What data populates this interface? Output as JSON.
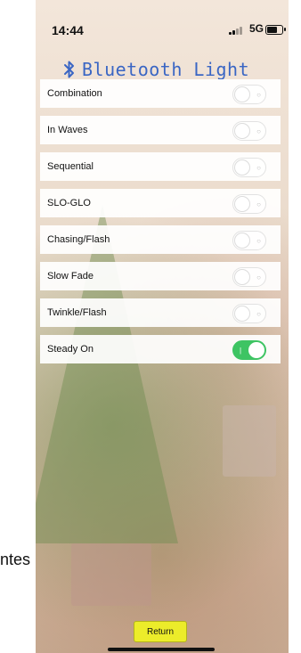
{
  "status_bar": {
    "time": "14:44",
    "network": "5G"
  },
  "app": {
    "title": "Bluetooth Light",
    "title_color": "#3a66c4"
  },
  "modes": [
    {
      "label": "Combination",
      "on": false
    },
    {
      "label": "In Waves",
      "on": false
    },
    {
      "label": "Sequential",
      "on": false
    },
    {
      "label": "SLO-GLO",
      "on": false
    },
    {
      "label": "Chasing/Flash",
      "on": false
    },
    {
      "label": "Slow Fade",
      "on": false
    },
    {
      "label": "Twinkle/Flash",
      "on": false
    },
    {
      "label": "Steady On",
      "on": true
    }
  ],
  "footer": {
    "return_label": "Return",
    "return_color": "#ecec2a"
  },
  "stray_text": "ntes",
  "colors": {
    "switch_on": "#3ec463"
  }
}
